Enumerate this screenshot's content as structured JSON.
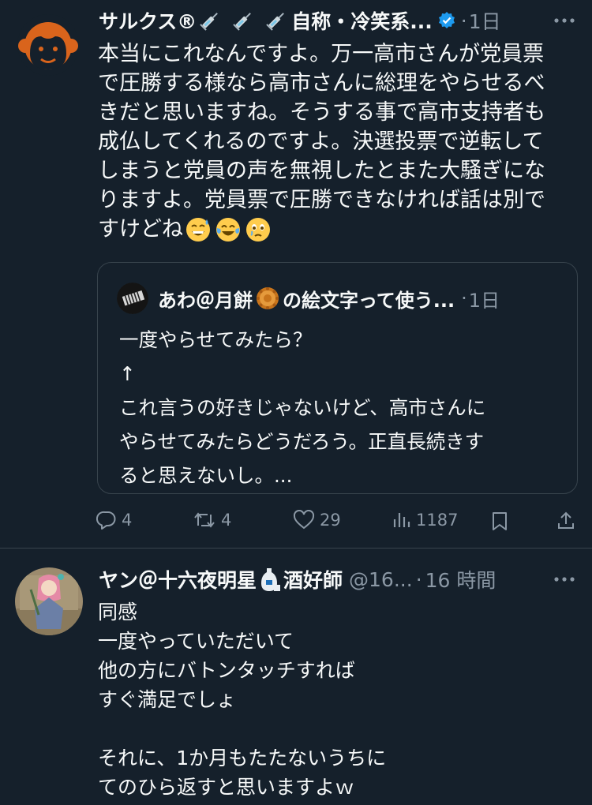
{
  "tweet1": {
    "display_name": "サルクス®",
    "name_suffix": "自称・冷笑系...",
    "time": "1日",
    "body_lines": [
      "本当にこれなんですよ。万一高市さんが党員票",
      "で圧勝する様なら高市さんに総理をやらせるべ",
      "きだと思いますね。そうする事で高市支持者も",
      "成仏してくれるのですよ。決選投票で逆転して",
      "しまうと党員の声を無視したとまた大騒ぎにな",
      "りますよ。党員票で圧勝できなければ話は別で",
      "すけどね"
    ],
    "quote": {
      "display_name": "あわ＠月餅",
      "name_suffix": "の絵文字って使う...",
      "time": "1日",
      "body_lines": [
        "一度やらせてみたら？",
        "↑",
        "これ言うの好きじゃないけど、高市さんに",
        "やらせてみたらどうだろう。正直長続きす",
        "ると思えないし。..."
      ]
    },
    "actions": {
      "replies": "4",
      "retweets": "4",
      "likes": "29",
      "views": "1187"
    }
  },
  "tweet2": {
    "display_name": "ヤン＠十六夜明星",
    "name_suffix": "酒好師",
    "handle": "@16...",
    "time": "16 時間",
    "body_lines": [
      "同感",
      "一度やっていただいて",
      "他の方にバトンタッチすれば",
      "すぐ満足でしょ",
      "",
      "それに、1か月もたたないうちに",
      "てのひら返すと思いますよｗ"
    ]
  },
  "colors": {
    "background": "#15202b",
    "text": "#f7f9f9",
    "secondary": "#8b98a5",
    "border": "#38444d",
    "verified": "#1d9bf0",
    "monkey": "#d9641c"
  },
  "icons": [
    "monkey-avatar",
    "syringe-icon",
    "verified-badge-icon",
    "more-icon",
    "mooncake-emoji",
    "grin-sweat-emoji",
    "tears-of-joy-emoji",
    "holding-tears-emoji",
    "reply-icon",
    "retweet-icon",
    "like-icon",
    "views-icon",
    "bookmark-icon",
    "share-icon",
    "sake-icon"
  ]
}
